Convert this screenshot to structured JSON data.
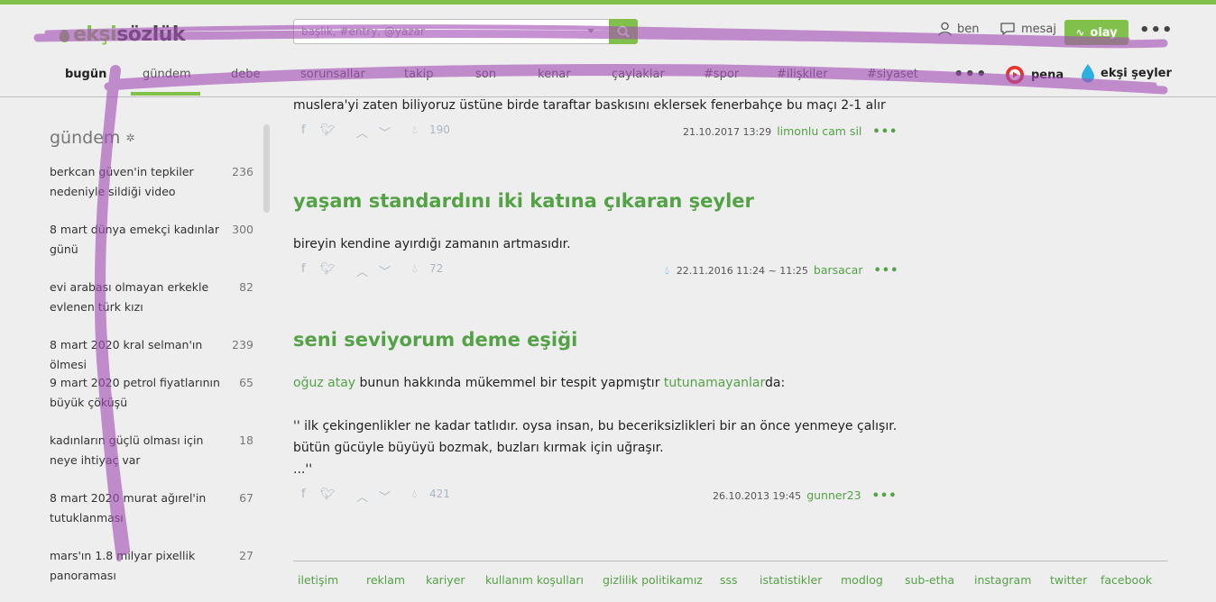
{
  "colors": {
    "accent": "#81c14b",
    "link": "#53a245",
    "scribble": "#a34fb5"
  },
  "header": {
    "logo_part1": "ekşi",
    "logo_part2": "sözlük",
    "search_placeholder": "başlık, #entry, @yazar",
    "user_label": "ben",
    "message_label": "mesaj",
    "olay_label": "olay"
  },
  "nav": {
    "items": [
      "bugün",
      "gündem",
      "debe",
      "sorunsallar",
      "takip",
      "son",
      "kenar",
      "çaylaklar",
      "#spor",
      "#ilişkiler",
      "#siyaset"
    ],
    "pena_label": "pena",
    "eksi_seyler_label": "ekşi şeyler"
  },
  "sidebar": {
    "title": "gündem",
    "items": [
      {
        "title": "berkcan güven'in tepkiler nedeniyle sildiği video",
        "count": "236"
      },
      {
        "title": "8 mart dünya emekçi kadınlar günü",
        "count": "300"
      },
      {
        "title": "evi arabası olmayan erkekle evlenen türk kızı",
        "count": "82"
      },
      {
        "title": "8 mart 2020 kral selman'ın ölmesi",
        "count": "239"
      },
      {
        "title": "9 mart 2020 petrol fiyatlarının büyük çöküşü",
        "count": "65"
      },
      {
        "title": "kadınların güçlü olması için neye ihtiyaç var",
        "count": "18"
      },
      {
        "title": "8 mart 2020 murat ağırel'in tutuklanması",
        "count": "67"
      },
      {
        "title": "mars'ın 1.8 milyar pixellik panoraması",
        "count": "27"
      }
    ]
  },
  "entries": [
    {
      "text": "muslera'yi zaten biliyoruz üstüne birde taraftar baskısını eklersek fenerbahçe bu maçı 2-1 alır",
      "favorites": "190",
      "date": "21.10.2017 13:29",
      "author": "limonlu cam sil"
    },
    {
      "topic": "yaşam standardını iki katına çıkaran şeyler",
      "text": "bireyin kendine ayırdığı zamanın artmasıdır.",
      "favorites": "72",
      "date": "22.11.2016 11:24 ~ 11:25",
      "author": "barsacar"
    },
    {
      "topic": "seni seviyorum deme eşiği",
      "link1": "oğuz atay",
      "text_mid": " bunun hakkında mükemmel bir tespit yapmıştır ",
      "link2": "tutunamayanlar",
      "text_end": "da:",
      "quote1": "'' ilk çekingenlikler ne kadar tatlıdır. oysa insan, bu beceriksizlikleri bir an önce yenmeye çalışır.",
      "quote2": "bütün gücüyle büyüyü bozmak, buzları kırmak için uğraşır.",
      "quote3": "...''",
      "favorites": "421",
      "date": "26.10.2013 19:45",
      "author": "gunner23"
    }
  ],
  "footer": {
    "links": [
      "iletişim",
      "reklam",
      "kariyer",
      "kullanım koşulları",
      "gizlilik politikamız",
      "sss",
      "istatistikler",
      "modlog",
      "sub-etha",
      "instagram",
      "twitter",
      "facebook"
    ]
  },
  "icons": [
    "search-icon",
    "user-icon",
    "message-icon",
    "pulse-icon",
    "more-icon",
    "gear-icon",
    "facebook-icon",
    "twitter-icon",
    "upvote-icon",
    "downvote-icon",
    "favorite-drop-icon",
    "pena-icon",
    "eksi-seyler-drop-icon"
  ]
}
